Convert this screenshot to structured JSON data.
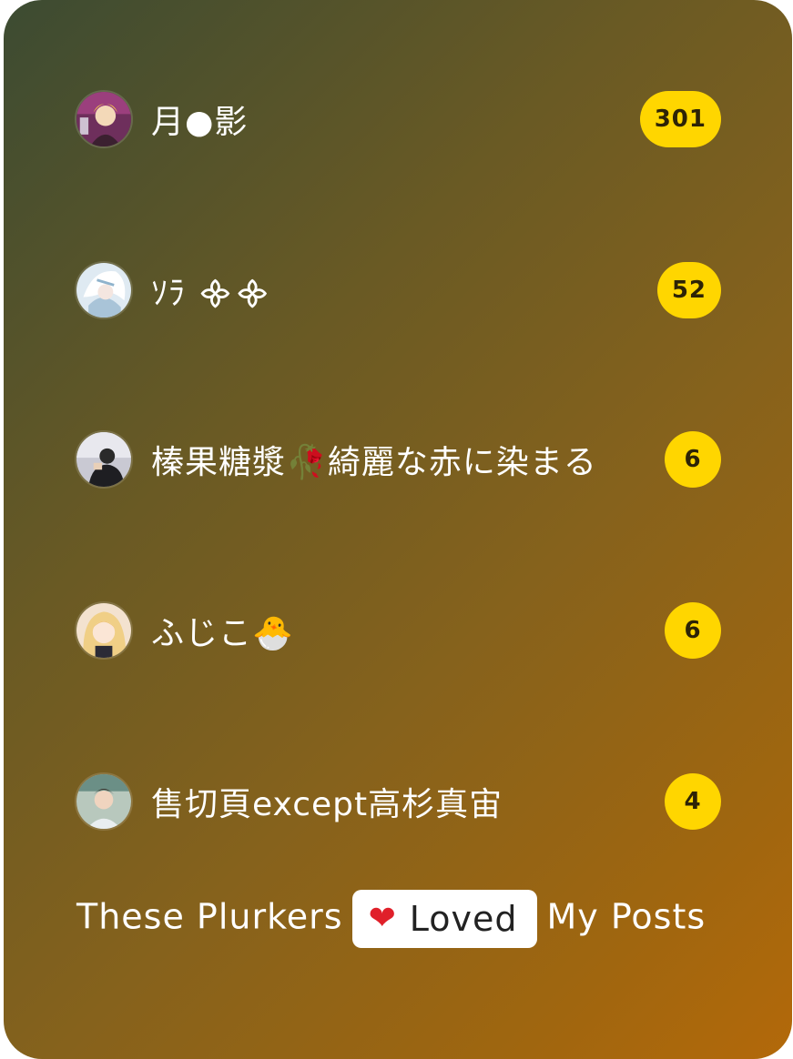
{
  "plurkers": [
    {
      "name": "月●影",
      "count": "301",
      "avatar_icon": "avatar-blonde-character",
      "avatar_color": "#7a3b6e"
    },
    {
      "name": "ｿﾗ ᯽᯽",
      "count": "52",
      "avatar_icon": "avatar-white-hair-character",
      "avatar_color": "#bcd6e6"
    },
    {
      "name": "榛果糖漿🥀綺麗な赤に染まる",
      "count": "6",
      "avatar_icon": "avatar-person-photo",
      "avatar_color": "#5a5a66"
    },
    {
      "name": "ふじこ🐣",
      "count": "6",
      "avatar_icon": "avatar-blonde-girl",
      "avatar_color": "#e9c7a0"
    },
    {
      "name": "售切頁except高杉真宙",
      "count": "4",
      "avatar_icon": "avatar-person-selfie",
      "avatar_color": "#9bb0a4"
    }
  ],
  "footer": {
    "before": "These Plurkers",
    "chip_heart": "❤",
    "chip_label": "Loved",
    "after": "My Posts"
  },
  "colors": {
    "badge": "#ffd600",
    "gradient_start": "#3c4b32",
    "gradient_end": "#b3690a"
  }
}
